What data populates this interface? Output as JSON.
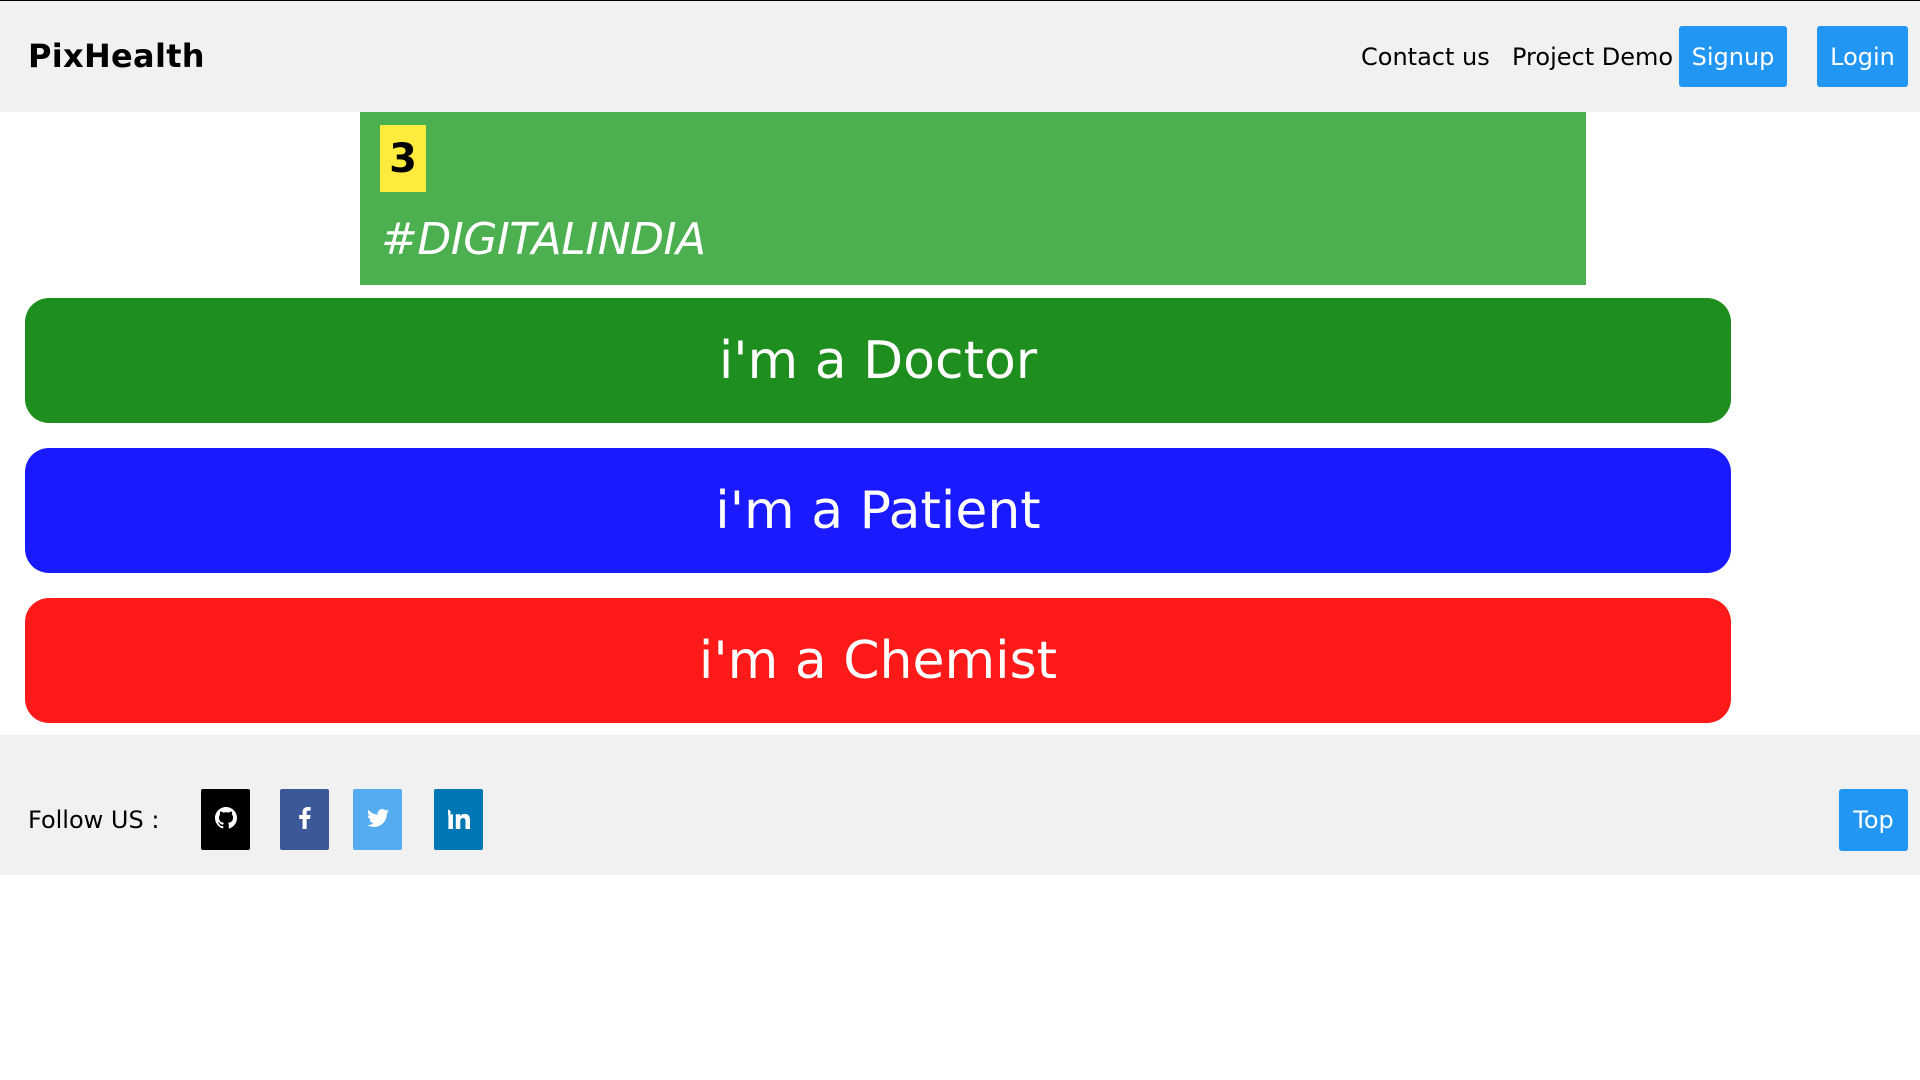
{
  "header": {
    "brand": "PixHealth",
    "nav": {
      "contact": "Contact us",
      "demo": "Project Demo"
    },
    "signup_label": "Signup",
    "login_label": "Login"
  },
  "banner": {
    "badge": "3",
    "slogan": "#DIGITALINDIA"
  },
  "roles": {
    "doctor": "i'm a Doctor",
    "patient": "i'm a Patient",
    "chemist": "i'm a Chemist"
  },
  "footer": {
    "follow_label": "Follow US :",
    "social_icons": [
      "github-icon",
      "facebook-icon",
      "twitter-icon",
      "linkedin-icon"
    ],
    "top_label": "Top"
  },
  "colors": {
    "header_bg": "#f1f1f1",
    "accent_blue": "#2196f3",
    "banner_green": "#4caf50",
    "badge_yellow": "#ffeb3b",
    "doctor_green": "#1e8e1e",
    "patient_blue": "#1a1aff",
    "chemist_red": "#ff1a1a"
  }
}
